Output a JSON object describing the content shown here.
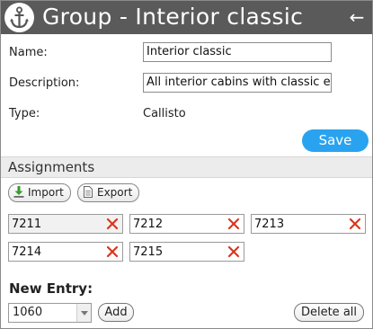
{
  "title": "Group - Interior classic",
  "icons": {
    "logo": "anchor-icon",
    "back": "arrow-left-icon"
  },
  "back_glyph": "←",
  "form": {
    "name_label": "Name:",
    "name_value": "Interior classic",
    "description_label": "Description:",
    "description_value": "All interior cabins with classic e",
    "type_label": "Type:",
    "type_value": "Callisto",
    "save_label": "Save"
  },
  "assignments": {
    "header": "Assignments",
    "import_label": "Import",
    "export_label": "Export",
    "items": [
      "7211",
      "7212",
      "7213",
      "7214",
      "7215"
    ]
  },
  "new_entry": {
    "label": "New Entry:",
    "selected": "1060",
    "add_label": "Add",
    "delete_all_label": "Delete all"
  },
  "colors": {
    "titlebar": "#5a5a5a",
    "accent": "#29a3f0",
    "remove": "#d9361e"
  }
}
